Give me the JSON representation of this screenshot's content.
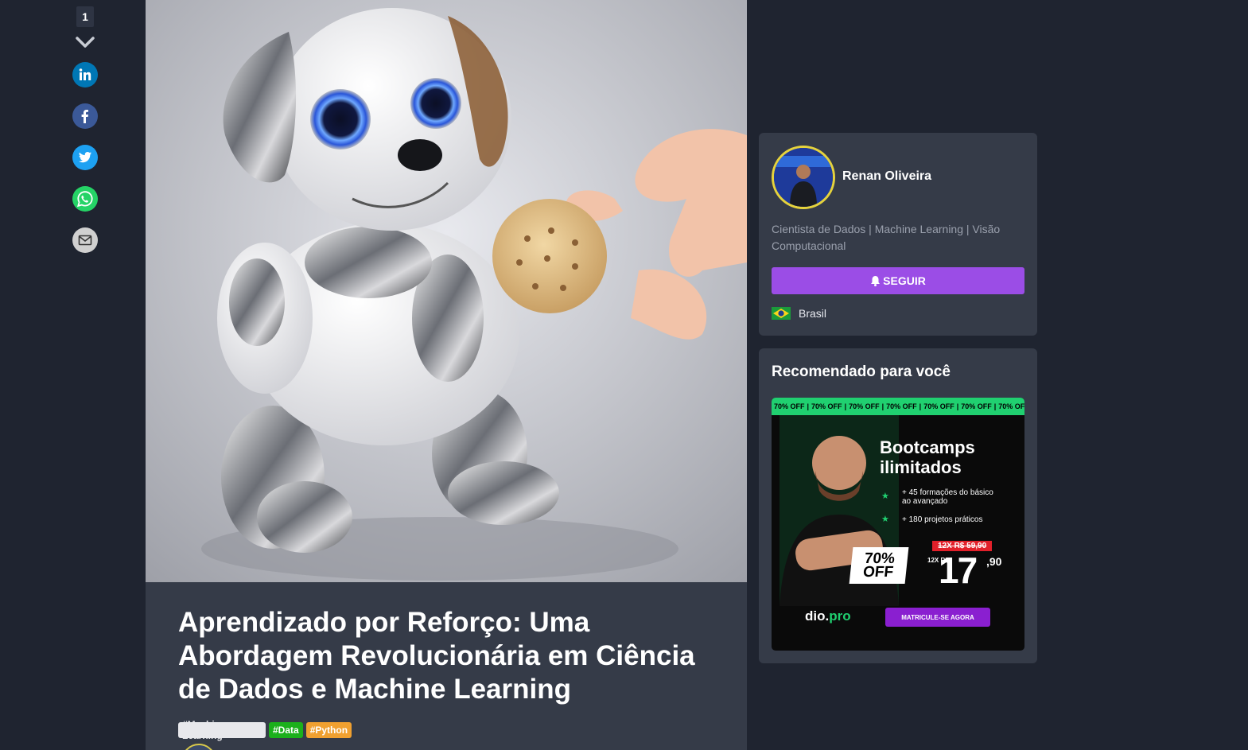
{
  "share_rail": {
    "count": "1",
    "icons": [
      "linkedin-icon",
      "facebook-icon",
      "twitter-icon",
      "whatsapp-icon",
      "email-icon"
    ],
    "colors": {
      "linkedin": "#0077b5",
      "facebook": "#3b5998",
      "twitter": "#1da1f2",
      "whatsapp": "#25d366",
      "email": "#d0d0d0"
    }
  },
  "article": {
    "title": "Aprendizado por Reforço: Uma Abordagem Revolucionária em Ciência de Dados e Machine Learning",
    "tags": [
      {
        "label": "#Machine Learning",
        "color": "#e8e8ec"
      },
      {
        "label": "#Data",
        "color": "#1bb01b"
      },
      {
        "label": "#Python",
        "color": "#f0a030"
      }
    ]
  },
  "author": {
    "name": "Renan Oliveira",
    "bio": "Cientista de Dados | Machine Learning | Visão Computacional",
    "follow_label": "SEGUIR",
    "country": "Brasil"
  },
  "recommended": {
    "title": "Recomendado para você",
    "ad": {
      "strip_text": "70% OFF",
      "headline": "Bootcamps ilimitados",
      "bullets": [
        "+ 45 formações do básico ao avançado",
        "+ 180 projetos práticos"
      ],
      "badge": "70% OFF",
      "old_price": "12X R$ 59,90",
      "installments": "12X R$",
      "price": "17",
      "cents": ",90",
      "brand": "dio.",
      "brand_pro": "pro",
      "cta": "MATRICULE-SE AGORA"
    }
  },
  "theme": {
    "accent": "#9b4de6",
    "page_bg": "#1f2430",
    "card_bg": "#353b48"
  }
}
